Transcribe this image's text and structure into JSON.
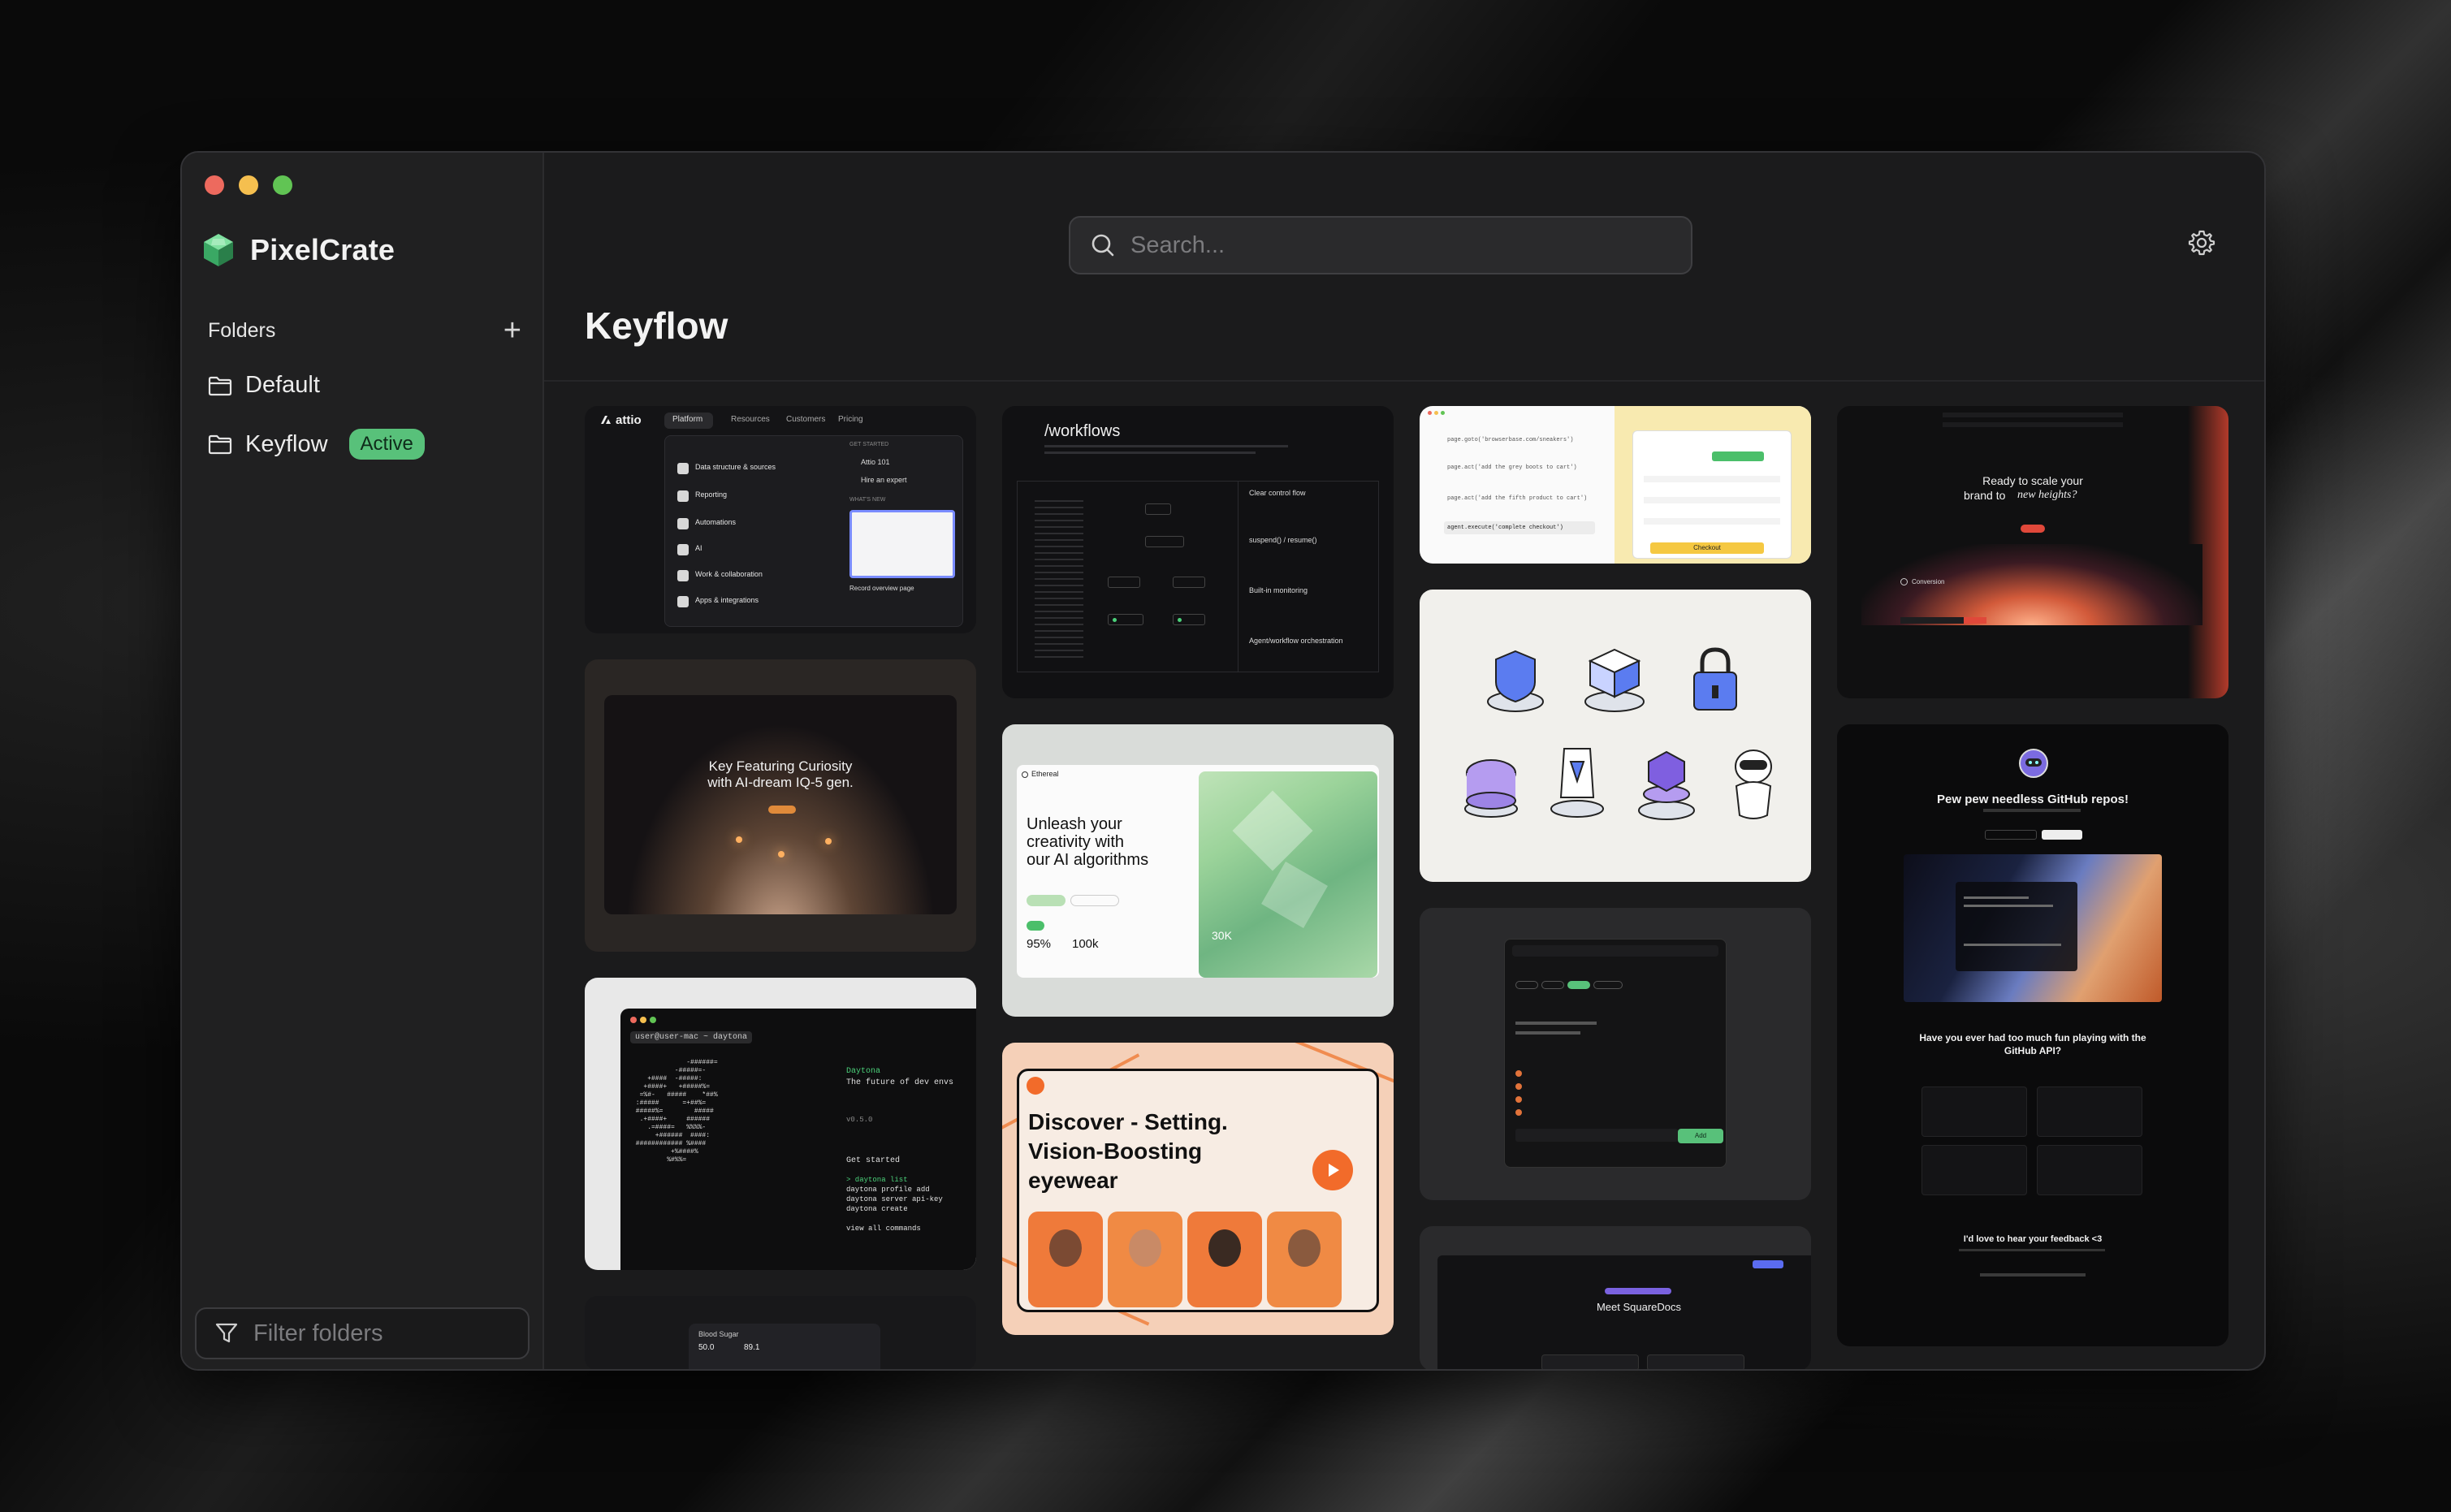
{
  "app": {
    "name": "PixelCrate"
  },
  "sidebar": {
    "folders_title": "Folders",
    "folders": [
      {
        "label": "Default"
      },
      {
        "label": "Keyflow",
        "badge": "Active"
      }
    ],
    "filter_placeholder": "Filter folders"
  },
  "search": {
    "placeholder": "Search..."
  },
  "page": {
    "title": "Keyflow"
  },
  "cards": {
    "attio": {
      "logo": "attio",
      "nav": [
        "Platform",
        "Resources",
        "Customers",
        "Pricing"
      ],
      "items": [
        "Data structure & sources",
        "Reporting",
        "Automations",
        "AI",
        "Work & collaboration",
        "Apps & integrations"
      ],
      "side": [
        "GET STARTED",
        "Attio 101",
        "Hire an expert",
        "WHAT'S NEW",
        "Record overview page"
      ]
    },
    "workflows": {
      "title": "/workflows",
      "items": [
        "Clear control flow",
        "suspend() / resume()",
        "Built-in monitoring",
        "Agent/workflow orchestration"
      ]
    },
    "checkout": {
      "lines": [
        "page.goto('browserbase.com/sneakers')",
        "page.act('add the grey boots to cart')",
        "page.act('add the fifth product to cart')",
        "agent.execute('complete checkout')"
      ],
      "button": "Checkout"
    },
    "conversion": {
      "title_line1": "Ready to scale your",
      "title_line2": "brand to",
      "title_emph": "new heights?",
      "brand": "Conversion"
    },
    "curiosity": {
      "title_line1": "Key Featuring Curiosity",
      "title_line2": "with AI-dream IQ-5 gen."
    },
    "ethereal": {
      "brand": "Ethereal",
      "headline": [
        "Unleash your",
        "creativity with",
        "our AI algorithms"
      ],
      "stat1": "95%",
      "stat2": "100k",
      "stat3": "30K"
    },
    "github": {
      "title": "Pew pew needless GitHub repos!",
      "subtitle": "Have you ever had too much fun playing with the GitHub API?",
      "footer": "I'd love to hear your feedback <3"
    },
    "daytona": {
      "prompt": "user@user-mac ~ daytona",
      "brand": "Daytona",
      "tagline": "The future of dev envs",
      "version": "v0.5.0",
      "get_started": "Get started",
      "commands": [
        "> daytona list",
        "  daytona profile add",
        "  daytona server api-key",
        "  daytona create",
        "",
        "  view all commands"
      ]
    },
    "eyewear": {
      "headline": [
        "Discover - Setting.",
        "Vision-Boosting",
        "eyewear"
      ]
    },
    "tasks": {
      "add": "Add"
    },
    "squaredocs": {
      "title": "Meet SquareDocs"
    },
    "blood": {
      "label": "Blood Sugar",
      "v1": "50.0",
      "v2": "89.1"
    }
  },
  "colors": {
    "accent_green": "#58c17a",
    "window_bg": "#1b1b1c",
    "sidebar_bg": "#202021"
  }
}
